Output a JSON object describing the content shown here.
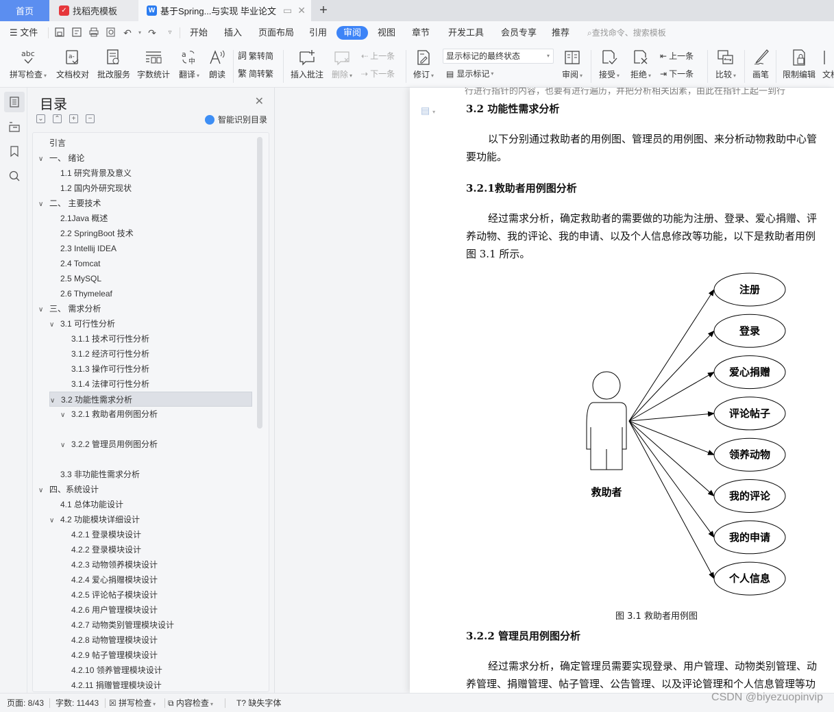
{
  "tabs": {
    "home": "首页",
    "template": "找稻壳模板",
    "document": "基于Spring...与实现 毕业论文",
    "add": "+"
  },
  "menu": {
    "file": "文件",
    "items": [
      "开始",
      "插入",
      "页面布局",
      "引用",
      "审阅",
      "视图",
      "章节",
      "开发工具",
      "会员专享",
      "推荐"
    ],
    "active": "审阅",
    "search_placeholder": "查找命令、搜索模板"
  },
  "ribbon": {
    "spell_check": "拼写检查",
    "doc_proofread": "文档校对",
    "revision_service": "批改服务",
    "word_count": "字数统计",
    "translate": "翻译",
    "read_aloud": "朗读",
    "trad_to_simp": "繁转简",
    "simp_to_trad": "简转繁",
    "insert_comment": "插入批注",
    "delete": "删除",
    "prev_comment": "上一条",
    "next_comment": "下一条",
    "track_changes": "修订",
    "markup_state": "显示标记的最终状态",
    "show_markup": "显示标记",
    "review": "审阅",
    "accept": "接受",
    "reject": "拒绝",
    "prev_change": "上一条",
    "next_change": "下一条",
    "compare": "比较",
    "ink": "画笔",
    "restrict_editing": "限制编辑",
    "doc_more": "文档"
  },
  "toc": {
    "title": "目录",
    "smart_label": "智能识别目录",
    "items": [
      {
        "label": "引言",
        "level": 0,
        "chevron": false
      },
      {
        "label": "一、  绪论",
        "level": 0,
        "chevron": true
      },
      {
        "label": "1.1 研究背景及意义",
        "level": 1,
        "chevron": false
      },
      {
        "label": "1.2 国内外研究现状",
        "level": 1,
        "chevron": false
      },
      {
        "label": "二、  主要技术",
        "level": 0,
        "chevron": true
      },
      {
        "label": "2.1Java 概述",
        "level": 1,
        "chevron": false
      },
      {
        "label": "2.2 SpringBoot 技术",
        "level": 1,
        "chevron": false
      },
      {
        "label": "2.3 Intellij IDEA",
        "level": 1,
        "chevron": false
      },
      {
        "label": "2.4 Tomcat",
        "level": 1,
        "chevron": false
      },
      {
        "label": "2.5 MySQL",
        "level": 1,
        "chevron": false
      },
      {
        "label": "2.6 Thymeleaf",
        "level": 1,
        "chevron": false
      },
      {
        "label": "三、  需求分析",
        "level": 0,
        "chevron": true
      },
      {
        "label": "3.1 可行性分析",
        "level": 1,
        "chevron": true
      },
      {
        "label": "3.1.1  技术可行性分析",
        "level": 2,
        "chevron": false
      },
      {
        "label": "3.1.2  经济可行性分析",
        "level": 2,
        "chevron": false
      },
      {
        "label": "3.1.3  操作可行性分析",
        "level": 2,
        "chevron": false
      },
      {
        "label": "3.1.4  法律可行性分析",
        "level": 2,
        "chevron": false
      },
      {
        "label": "3.2  功能性需求分析",
        "level": 1,
        "chevron": true,
        "selected": true
      },
      {
        "label": "3.2.1 救助者用例图分析",
        "level": 2,
        "chevron": true
      },
      {
        "label": "",
        "level": 2,
        "chevron": false
      },
      {
        "label": "3.2.2  管理员用例图分析",
        "level": 2,
        "chevron": true
      },
      {
        "label": "",
        "level": 2,
        "chevron": false
      },
      {
        "label": "3.3  非功能性需求分析",
        "level": 1,
        "chevron": false
      },
      {
        "label": "四、系统设计",
        "level": 0,
        "chevron": true
      },
      {
        "label": "4.1  总体功能设计",
        "level": 1,
        "chevron": false
      },
      {
        "label": "4.2  功能模块详细设计",
        "level": 1,
        "chevron": true
      },
      {
        "label": "4.2.1  登录模块设计",
        "level": 2,
        "chevron": false
      },
      {
        "label": "4.2.2  登录模块设计",
        "level": 2,
        "chevron": false
      },
      {
        "label": "4.2.3  动物领养模块设计",
        "level": 2,
        "chevron": false
      },
      {
        "label": "4.2.4 爱心捐赠模块设计",
        "level": 2,
        "chevron": false
      },
      {
        "label": "4.2.5 评论帖子模块设计",
        "level": 2,
        "chevron": false
      },
      {
        "label": "4.2.6 用户管理模块设计",
        "level": 2,
        "chevron": false
      },
      {
        "label": "4.2.7 动物类别管理模块设计",
        "level": 2,
        "chevron": false
      },
      {
        "label": "4.2.8 动物管理模块设计",
        "level": 2,
        "chevron": false
      },
      {
        "label": "4.2.9 帖子管理模块设计",
        "level": 2,
        "chevron": false
      },
      {
        "label": "4.2.10 领养管理模块设计",
        "level": 2,
        "chevron": false
      },
      {
        "label": "4.2.11 捐赠管理模块设计",
        "level": 2,
        "chevron": false
      }
    ]
  },
  "document": {
    "ghost_line": "行进行指针的内容，也要有进行遍历，并把分析相关因素，由此在指针上起一到行",
    "h_3_2": "3.2 功能性需求分析",
    "p1_line1": "以下分别通过救助者的用例图、管理员的用例图、来分析动物救助中心管",
    "p1_line2": "要功能。",
    "h_3_2_1": "3.2.1救助者用例图分析",
    "p2_line1": "经过需求分析，确定救助者的需要做的功能为注册、登录、爱心捐赠、评",
    "p2_line2": "养动物、我的评论、我的申请、以及个人信息修改等功能，以下是救助者用例",
    "p2_line3": "图 3.1 所示。",
    "diagram": {
      "actor": "救助者",
      "use_cases": [
        "注册",
        "登录",
        "爱心捐赠",
        "评论帖子",
        "领养动物",
        "我的评论",
        "我的申请",
        "个人信息"
      ],
      "caption": "图 3.1 救助者用例图"
    },
    "h_3_2_2": "3.2.2 管理员用例图分析",
    "p3_line1": "经过需求分析，确定管理员需要实现登录、用户管理、动物类别管理、动",
    "p3_line2": "养管理、捐赠管理、帖子管理、公告管理、以及评论管理和个人信息管理等功"
  },
  "status": {
    "page": "页面: 8/43",
    "words": "字数: 11443",
    "spell_check": "拼写检查",
    "content_check": "内容检查",
    "missing_fonts": "缺失字体"
  },
  "watermark": "CSDN @biyezuopinvip"
}
